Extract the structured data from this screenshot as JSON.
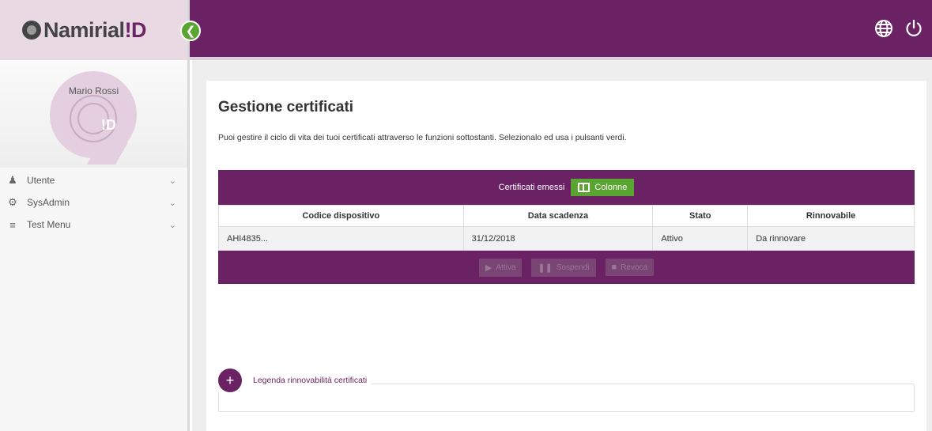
{
  "brand": {
    "name_main": "Namirial",
    "name_suffix": "!D"
  },
  "user": {
    "name": "Mario Rossi",
    "avatar_mark": "!D"
  },
  "sidebar": {
    "items": [
      {
        "label": "Utente",
        "icon": "user-icon"
      },
      {
        "label": "SysAdmin",
        "icon": "gears-icon"
      },
      {
        "label": "Test Menu",
        "icon": "list-icon"
      }
    ]
  },
  "header": {
    "icons": [
      "globe-icon",
      "power-icon"
    ]
  },
  "page": {
    "title": "Gestione certificati",
    "subtitle": "Puoi gestire il ciclo di vita dei tuoi certificati attraverso le funzioni sottostanti. Selezionalo ed usa i pulsanti verdi."
  },
  "table": {
    "caption": "Certificati emessi",
    "columns_button": "Colonne",
    "headers": [
      "Codice dispositivo",
      "Data scadenza",
      "Stato",
      "Rinnovabile"
    ],
    "rows": [
      [
        "AHI4835...",
        "31/12/2018",
        "Attivo",
        "Da rinnovare"
      ]
    ],
    "actions": [
      "Attiva",
      "Sospendi",
      "Revoca"
    ]
  },
  "legend": {
    "label": "Legenda rinnovabilità certificati"
  },
  "colors": {
    "brand": "#6b2265",
    "accent": "#5aa531"
  }
}
